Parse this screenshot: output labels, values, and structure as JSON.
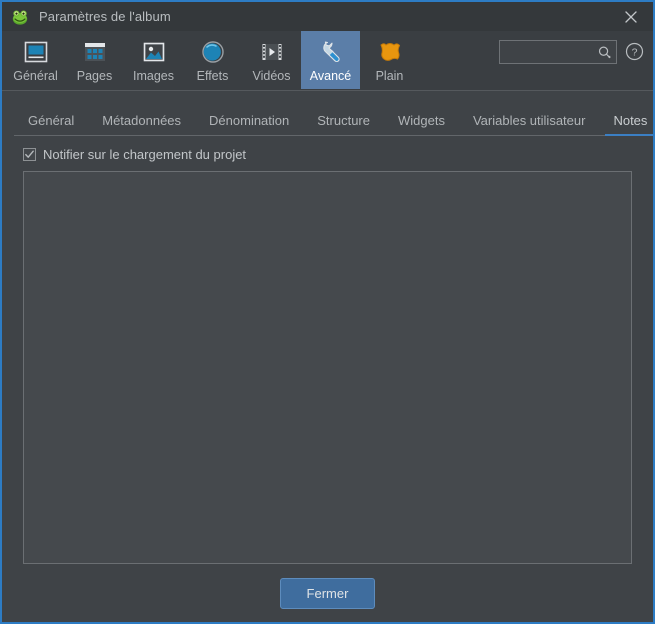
{
  "window": {
    "title": "Paramètres de l'album",
    "app_icon": "frog-icon",
    "close_icon": "close-icon",
    "accent_color": "#2d7cc4",
    "background_color": "#3f4347",
    "titlebar_color": "#34383b"
  },
  "toolbar": {
    "items": [
      {
        "label": "Général",
        "icon": "general-icon",
        "active": false
      },
      {
        "label": "Pages",
        "icon": "pages-icon",
        "active": false
      },
      {
        "label": "Images",
        "icon": "images-icon",
        "active": false
      },
      {
        "label": "Effets",
        "icon": "effects-icon",
        "active": false
      },
      {
        "label": "Vidéos",
        "icon": "videos-icon",
        "active": false
      },
      {
        "label": "Avancé",
        "icon": "wrench-icon",
        "active": true
      },
      {
        "label": "Plain",
        "icon": "plain-icon",
        "active": false
      }
    ],
    "search": {
      "value": "",
      "placeholder": "",
      "icon": "search-icon"
    },
    "help": {
      "icon": "help-icon",
      "label": "?"
    }
  },
  "tabs": [
    {
      "label": "Général",
      "active": false
    },
    {
      "label": "Métadonnées",
      "active": false
    },
    {
      "label": "Dénomination",
      "active": false
    },
    {
      "label": "Structure",
      "active": false
    },
    {
      "label": "Widgets",
      "active": false
    },
    {
      "label": "Variables utilisateur",
      "active": false
    },
    {
      "label": "Notes",
      "active": true
    }
  ],
  "notes_panel": {
    "notify_checkbox": {
      "label": "Notifier sur le chargement du projet",
      "checked": true
    },
    "notes_text": {
      "value": "",
      "placeholder": ""
    }
  },
  "footer": {
    "close_label": "Fermer"
  }
}
